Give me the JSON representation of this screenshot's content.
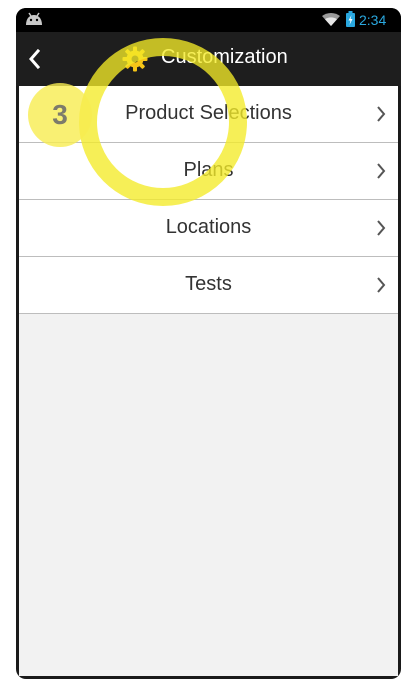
{
  "status_bar": {
    "time": "2:34",
    "icons": [
      "android-icon",
      "wifi-icon",
      "battery-icon"
    ],
    "accent_color": "#2aa8df"
  },
  "app_bar": {
    "title": "Customization",
    "back_icon": "chevron-left-icon",
    "title_icon": "gear-icon",
    "title_icon_color": "#f5c518"
  },
  "menu": {
    "items": [
      {
        "label": "Product Selections"
      },
      {
        "label": "Plans"
      },
      {
        "label": "Locations"
      },
      {
        "label": "Tests"
      }
    ]
  },
  "tutorial": {
    "step": "3",
    "highlight_color": "#f3ea28"
  }
}
